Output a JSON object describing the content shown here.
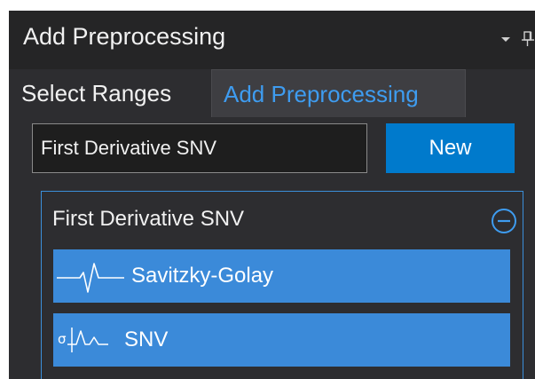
{
  "panel": {
    "title": "Add Preprocessing",
    "icons": {
      "menu": "chevron-down-icon",
      "pin": "pin-icon"
    }
  },
  "tabs": [
    {
      "label": "Select Ranges",
      "active": false
    },
    {
      "label": "Add Preprocessing",
      "active": true
    }
  ],
  "form": {
    "name_value": "First Derivative SNV",
    "new_label": "New"
  },
  "group": {
    "title": "First Derivative SNV",
    "remove_icon": "minus-circle-icon",
    "steps": [
      {
        "label": "Savitzky-Golay",
        "icon": "derivative-wave-icon"
      },
      {
        "label": "SNV",
        "icon": "snv-peak-icon"
      }
    ]
  },
  "colors": {
    "panel_bg": "#2d2d30",
    "title_bg": "#252526",
    "accent": "#007acc",
    "active_tab_text": "#3e9cf0",
    "step_bg": "#3b8ad9",
    "group_border": "#3b8fd9"
  }
}
